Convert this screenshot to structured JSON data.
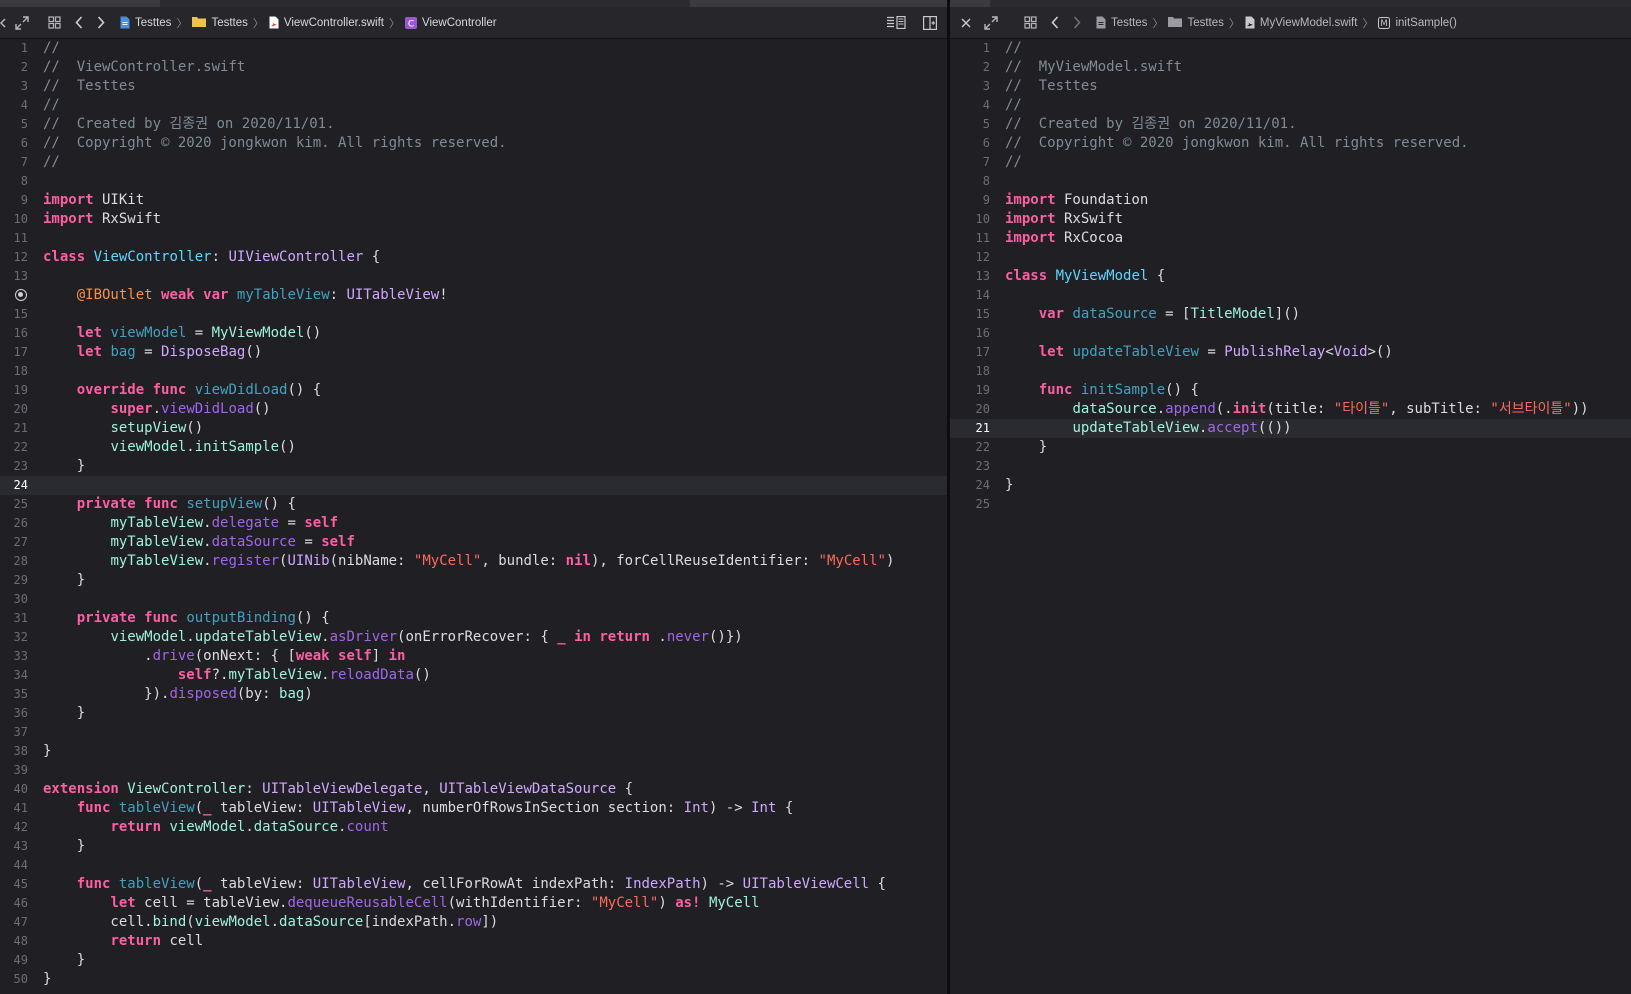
{
  "left_pane": {
    "breadcrumbs": [
      {
        "label": "Testtes",
        "icon": "project-file-icon"
      },
      {
        "label": "Testtes",
        "icon": "folder-icon"
      },
      {
        "label": "ViewController.swift",
        "icon": "swift-file-icon"
      },
      {
        "label": "ViewController",
        "icon": "class-c-icon"
      }
    ],
    "current_line": 24,
    "breakpoint_line": 14,
    "lines": [
      [
        [
          "cm",
          "//"
        ]
      ],
      [
        [
          "cm",
          "//  ViewController.swift"
        ]
      ],
      [
        [
          "cm",
          "//  Testtes"
        ]
      ],
      [
        [
          "cm",
          "//"
        ]
      ],
      [
        [
          "cm",
          "//  Created by 김종권 on 2020/11/01."
        ]
      ],
      [
        [
          "cm",
          "//  Copyright © 2020 jongkwon kim. All rights reserved."
        ]
      ],
      [
        [
          "cm",
          "//"
        ]
      ],
      [],
      [
        [
          "kw",
          "import"
        ],
        [
          "pl",
          " UIKit"
        ]
      ],
      [
        [
          "kw",
          "import"
        ],
        [
          "pl",
          " RxSwift"
        ]
      ],
      [],
      [
        [
          "kw",
          "class"
        ],
        [
          "pl",
          " "
        ],
        [
          "tyd",
          "ViewController"
        ],
        [
          "pl",
          ": "
        ],
        [
          "ty",
          "UIViewController"
        ],
        [
          "pl",
          " {"
        ]
      ],
      [],
      [
        [
          "pl",
          "    "
        ],
        [
          "attr",
          "@IBOutlet"
        ],
        [
          "pl",
          " "
        ],
        [
          "kw",
          "weak"
        ],
        [
          "pl",
          " "
        ],
        [
          "kw",
          "var"
        ],
        [
          "pl",
          " "
        ],
        [
          "dec",
          "myTableView"
        ],
        [
          "pl",
          ": "
        ],
        [
          "ty",
          "UITableView"
        ],
        [
          "pl",
          "!"
        ]
      ],
      [],
      [
        [
          "pl",
          "    "
        ],
        [
          "kw",
          "let"
        ],
        [
          "pl",
          " "
        ],
        [
          "dec",
          "viewModel"
        ],
        [
          "pl",
          " = "
        ],
        [
          "pj",
          "MyViewModel"
        ],
        [
          "pl",
          "()"
        ]
      ],
      [
        [
          "pl",
          "    "
        ],
        [
          "kw",
          "let"
        ],
        [
          "pl",
          " "
        ],
        [
          "dec",
          "bag"
        ],
        [
          "pl",
          " = "
        ],
        [
          "ty",
          "DisposeBag"
        ],
        [
          "pl",
          "()"
        ]
      ],
      [],
      [
        [
          "pl",
          "    "
        ],
        [
          "kw",
          "override"
        ],
        [
          "pl",
          " "
        ],
        [
          "kw",
          "func"
        ],
        [
          "pl",
          " "
        ],
        [
          "dec",
          "viewDidLoad"
        ],
        [
          "pl",
          "() {"
        ]
      ],
      [
        [
          "pl",
          "        "
        ],
        [
          "kw",
          "super"
        ],
        [
          "pl",
          "."
        ],
        [
          "otf",
          "viewDidLoad"
        ],
        [
          "pl",
          "()"
        ]
      ],
      [
        [
          "pl",
          "        "
        ],
        [
          "pj",
          "setupView"
        ],
        [
          "pl",
          "()"
        ]
      ],
      [
        [
          "pl",
          "        "
        ],
        [
          "pj",
          "viewModel"
        ],
        [
          "pl",
          "."
        ],
        [
          "pj",
          "initSample"
        ],
        [
          "pl",
          "()"
        ]
      ],
      [
        [
          "pl",
          "    }"
        ]
      ],
      [],
      [
        [
          "pl",
          "    "
        ],
        [
          "kw",
          "private"
        ],
        [
          "pl",
          " "
        ],
        [
          "kw",
          "func"
        ],
        [
          "pl",
          " "
        ],
        [
          "dec",
          "setupView"
        ],
        [
          "pl",
          "() {"
        ]
      ],
      [
        [
          "pl",
          "        "
        ],
        [
          "pj",
          "myTableView"
        ],
        [
          "pl",
          "."
        ],
        [
          "otf",
          "delegate"
        ],
        [
          "pl",
          " = "
        ],
        [
          "kw",
          "self"
        ]
      ],
      [
        [
          "pl",
          "        "
        ],
        [
          "pj",
          "myTableView"
        ],
        [
          "pl",
          "."
        ],
        [
          "otf",
          "dataSource"
        ],
        [
          "pl",
          " = "
        ],
        [
          "kw",
          "self"
        ]
      ],
      [
        [
          "pl",
          "        "
        ],
        [
          "pj",
          "myTableView"
        ],
        [
          "pl",
          "."
        ],
        [
          "otf",
          "register"
        ],
        [
          "pl",
          "("
        ],
        [
          "ty",
          "UINib"
        ],
        [
          "pl",
          "(nibName: "
        ],
        [
          "str",
          "\"MyCell\""
        ],
        [
          "pl",
          ", bundle: "
        ],
        [
          "kw",
          "nil"
        ],
        [
          "pl",
          "), forCellReuseIdentifier: "
        ],
        [
          "str",
          "\"MyCell\""
        ],
        [
          "pl",
          ")"
        ]
      ],
      [
        [
          "pl",
          "    }"
        ]
      ],
      [],
      [
        [
          "pl",
          "    "
        ],
        [
          "kw",
          "private"
        ],
        [
          "pl",
          " "
        ],
        [
          "kw",
          "func"
        ],
        [
          "pl",
          " "
        ],
        [
          "dec",
          "outputBinding"
        ],
        [
          "pl",
          "() {"
        ]
      ],
      [
        [
          "pl",
          "        "
        ],
        [
          "pj",
          "viewModel"
        ],
        [
          "pl",
          "."
        ],
        [
          "pj",
          "updateTableView"
        ],
        [
          "pl",
          "."
        ],
        [
          "otf",
          "asDriver"
        ],
        [
          "pl",
          "(onErrorRecover: { "
        ],
        [
          "kw",
          "_"
        ],
        [
          "pl",
          " "
        ],
        [
          "kw",
          "in"
        ],
        [
          "pl",
          " "
        ],
        [
          "kw",
          "return"
        ],
        [
          "pl",
          " ."
        ],
        [
          "otf",
          "never"
        ],
        [
          "pl",
          "()})"
        ]
      ],
      [
        [
          "pl",
          "            ."
        ],
        [
          "otf",
          "drive"
        ],
        [
          "pl",
          "(onNext: { ["
        ],
        [
          "kw",
          "weak"
        ],
        [
          "pl",
          " "
        ],
        [
          "kw",
          "self"
        ],
        [
          "pl",
          "] "
        ],
        [
          "kw",
          "in"
        ]
      ],
      [
        [
          "pl",
          "                "
        ],
        [
          "kw",
          "self"
        ],
        [
          "pl",
          "?."
        ],
        [
          "pj",
          "myTableView"
        ],
        [
          "pl",
          "."
        ],
        [
          "otf",
          "reloadData"
        ],
        [
          "pl",
          "()"
        ]
      ],
      [
        [
          "pl",
          "            })."
        ],
        [
          "otf",
          "disposed"
        ],
        [
          "pl",
          "(by: "
        ],
        [
          "pj",
          "bag"
        ],
        [
          "pl",
          ")"
        ]
      ],
      [
        [
          "pl",
          "    }"
        ]
      ],
      [],
      [
        [
          "pl",
          "}"
        ]
      ],
      [],
      [
        [
          "kw",
          "extension"
        ],
        [
          "pl",
          " "
        ],
        [
          "pj",
          "ViewController"
        ],
        [
          "pl",
          ": "
        ],
        [
          "ty",
          "UITableViewDelegate"
        ],
        [
          "pl",
          ", "
        ],
        [
          "ty",
          "UITableViewDataSource"
        ],
        [
          "pl",
          " {"
        ]
      ],
      [
        [
          "pl",
          "    "
        ],
        [
          "kw",
          "func"
        ],
        [
          "pl",
          " "
        ],
        [
          "dec",
          "tableView"
        ],
        [
          "pl",
          "("
        ],
        [
          "kw",
          "_"
        ],
        [
          "pl",
          " tableView: "
        ],
        [
          "ty",
          "UITableView"
        ],
        [
          "pl",
          ", numberOfRowsInSection section: "
        ],
        [
          "ty",
          "Int"
        ],
        [
          "pl",
          ") -> "
        ],
        [
          "ty",
          "Int"
        ],
        [
          "pl",
          " {"
        ]
      ],
      [
        [
          "pl",
          "        "
        ],
        [
          "kw",
          "return"
        ],
        [
          "pl",
          " "
        ],
        [
          "pj",
          "viewModel"
        ],
        [
          "pl",
          "."
        ],
        [
          "pj",
          "dataSource"
        ],
        [
          "pl",
          "."
        ],
        [
          "otf",
          "count"
        ]
      ],
      [
        [
          "pl",
          "    }"
        ]
      ],
      [],
      [
        [
          "pl",
          "    "
        ],
        [
          "kw",
          "func"
        ],
        [
          "pl",
          " "
        ],
        [
          "dec",
          "tableView"
        ],
        [
          "pl",
          "("
        ],
        [
          "kw",
          "_"
        ],
        [
          "pl",
          " tableView: "
        ],
        [
          "ty",
          "UITableView"
        ],
        [
          "pl",
          ", cellForRowAt indexPath: "
        ],
        [
          "ty",
          "IndexPath"
        ],
        [
          "pl",
          ") -> "
        ],
        [
          "ty",
          "UITableViewCell"
        ],
        [
          "pl",
          " {"
        ]
      ],
      [
        [
          "pl",
          "        "
        ],
        [
          "kw",
          "let"
        ],
        [
          "pl",
          " cell = tableView."
        ],
        [
          "otf",
          "dequeueReusableCell"
        ],
        [
          "pl",
          "(withIdentifier: "
        ],
        [
          "str",
          "\"MyCell\""
        ],
        [
          "pl",
          ") "
        ],
        [
          "kw",
          "as!"
        ],
        [
          "pl",
          " "
        ],
        [
          "pj",
          "MyCell"
        ]
      ],
      [
        [
          "pl",
          "        cell."
        ],
        [
          "pj",
          "bind"
        ],
        [
          "pl",
          "("
        ],
        [
          "pj",
          "viewModel"
        ],
        [
          "pl",
          "."
        ],
        [
          "pj",
          "dataSource"
        ],
        [
          "pl",
          "[indexPath."
        ],
        [
          "otf",
          "row"
        ],
        [
          "pl",
          "])"
        ]
      ],
      [
        [
          "pl",
          "        "
        ],
        [
          "kw",
          "return"
        ],
        [
          "pl",
          " cell"
        ]
      ],
      [
        [
          "pl",
          "    }"
        ]
      ],
      [
        [
          "pl",
          "}"
        ]
      ]
    ]
  },
  "right_pane": {
    "breadcrumbs": [
      {
        "label": "Testtes",
        "icon": "project-file-icon"
      },
      {
        "label": "Testtes",
        "icon": "folder-icon"
      },
      {
        "label": "MyViewModel.swift",
        "icon": "swift-file-icon"
      },
      {
        "label": "initSample()",
        "icon": "method-m-icon"
      }
    ],
    "current_line": 21,
    "lines": [
      [
        [
          "cm",
          "//"
        ]
      ],
      [
        [
          "cm",
          "//  MyViewModel.swift"
        ]
      ],
      [
        [
          "cm",
          "//  Testtes"
        ]
      ],
      [
        [
          "cm",
          "//"
        ]
      ],
      [
        [
          "cm",
          "//  Created by 김종권 on 2020/11/01."
        ]
      ],
      [
        [
          "cm",
          "//  Copyright © 2020 jongkwon kim. All rights reserved."
        ]
      ],
      [
        [
          "cm",
          "//"
        ]
      ],
      [],
      [
        [
          "kw",
          "import"
        ],
        [
          "pl",
          " Foundation"
        ]
      ],
      [
        [
          "kw",
          "import"
        ],
        [
          "pl",
          " RxSwift"
        ]
      ],
      [
        [
          "kw",
          "import"
        ],
        [
          "pl",
          " RxCocoa"
        ]
      ],
      [],
      [
        [
          "kw",
          "class"
        ],
        [
          "pl",
          " "
        ],
        [
          "tyd",
          "MyViewModel"
        ],
        [
          "pl",
          " {"
        ]
      ],
      [],
      [
        [
          "pl",
          "    "
        ],
        [
          "kw",
          "var"
        ],
        [
          "pl",
          " "
        ],
        [
          "dec",
          "dataSource"
        ],
        [
          "pl",
          " = ["
        ],
        [
          "pj",
          "TitleModel"
        ],
        [
          "pl",
          "]()"
        ]
      ],
      [],
      [
        [
          "pl",
          "    "
        ],
        [
          "kw",
          "let"
        ],
        [
          "pl",
          " "
        ],
        [
          "dec",
          "updateTableView"
        ],
        [
          "pl",
          " = "
        ],
        [
          "ty",
          "PublishRelay"
        ],
        [
          "pl",
          "<"
        ],
        [
          "ty",
          "Void"
        ],
        [
          "pl",
          ">()"
        ]
      ],
      [],
      [
        [
          "pl",
          "    "
        ],
        [
          "kw",
          "func"
        ],
        [
          "pl",
          " "
        ],
        [
          "dec",
          "initSample"
        ],
        [
          "pl",
          "() {"
        ]
      ],
      [
        [
          "pl",
          "        "
        ],
        [
          "pj",
          "dataSource"
        ],
        [
          "pl",
          "."
        ],
        [
          "otf",
          "append"
        ],
        [
          "pl",
          "(."
        ],
        [
          "kw",
          "init"
        ],
        [
          "pl",
          "(title: "
        ],
        [
          "str",
          "\"타이틀\""
        ],
        [
          "pl",
          ", subTitle: "
        ],
        [
          "str",
          "\"서브타이틀\""
        ],
        [
          "pl",
          "))"
        ]
      ],
      [
        [
          "pl",
          "        "
        ],
        [
          "pj",
          "updateTableView"
        ],
        [
          "pl",
          "."
        ],
        [
          "otf",
          "accept"
        ],
        [
          "pl",
          "(())"
        ]
      ],
      [
        [
          "pl",
          "    }"
        ]
      ],
      [],
      [
        [
          "pl",
          "}"
        ]
      ],
      []
    ]
  }
}
